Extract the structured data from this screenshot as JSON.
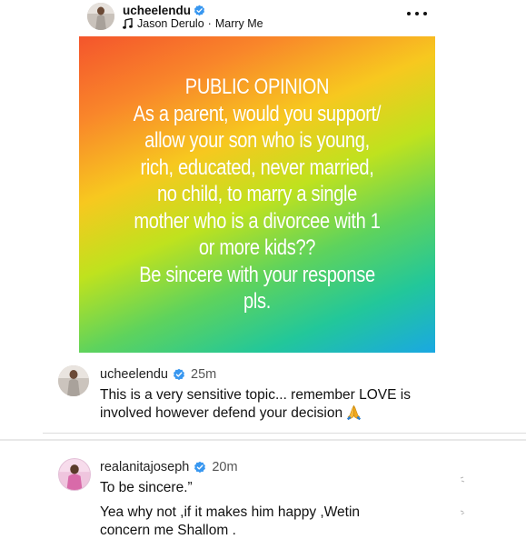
{
  "post": {
    "username": "ucheelendu",
    "verified": true,
    "music": {
      "artist": "Jason Derulo",
      "separator": "·",
      "song": "Marry Me"
    },
    "image_text_lines": [
      "PUBLIC OPINION",
      "As a parent, would you support/",
      "allow your son who is young,",
      "rich, educated, never married,",
      "no child, to marry a single",
      "mother who is a divorcee with 1",
      "or more kids??",
      "Be sincere with your response",
      "pls."
    ]
  },
  "comments": [
    {
      "username": "ucheelendu",
      "verified": true,
      "time": "25m",
      "lines": [
        "This is a very sensitive topic... remember LOVE is",
        "involved however defend your decision"
      ],
      "emoji": "folded-hands"
    },
    {
      "username": "realanitajoseph",
      "verified": true,
      "time": "20m",
      "lines": [
        "To be sincere.”",
        "Yea why not ,if it makes him happy ,Wetin",
        "concern me Shallom ."
      ]
    }
  ],
  "colors": {
    "verified_blue": "#3897f0",
    "gradient_start": "#f4552c",
    "gradient_end": "#1aa8e2"
  },
  "icons": {
    "music": "music-note-icon",
    "more": "more-horizontal-icon",
    "verified": "verified-badge-icon"
  }
}
